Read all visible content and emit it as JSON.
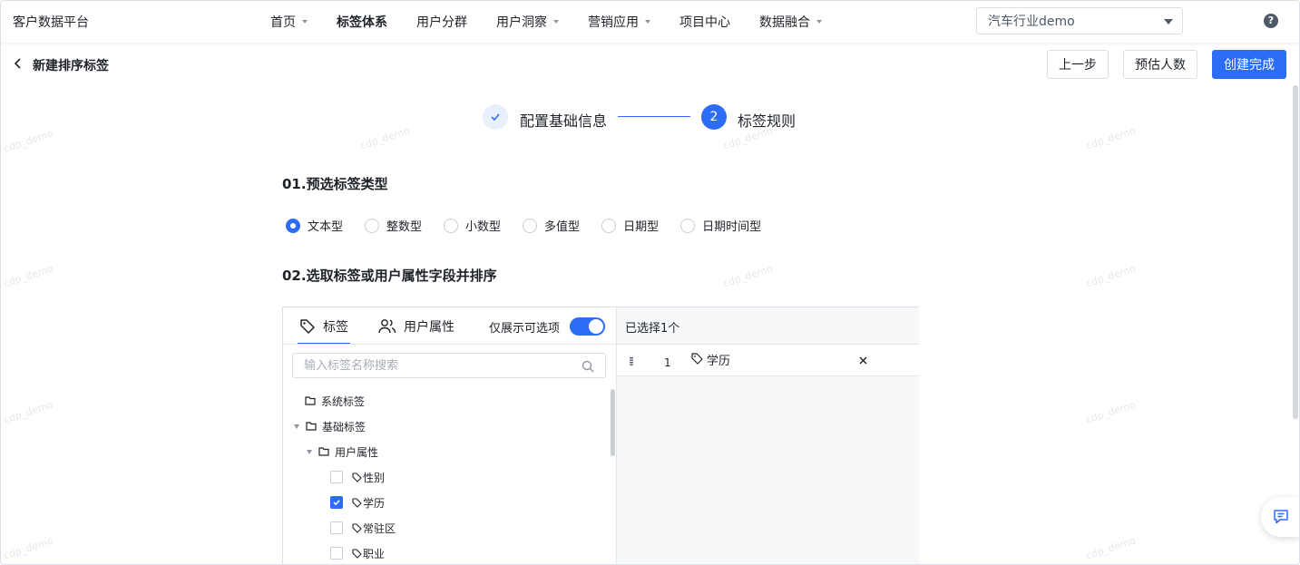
{
  "app": {
    "brand": "客户数据平台"
  },
  "nav": {
    "items": [
      {
        "label": "首页",
        "dropdown": true,
        "active": false
      },
      {
        "label": "标签体系",
        "dropdown": false,
        "active": true
      },
      {
        "label": "用户分群",
        "dropdown": false,
        "active": false
      },
      {
        "label": "用户洞察",
        "dropdown": true,
        "active": false
      },
      {
        "label": "营销应用",
        "dropdown": true,
        "active": false
      },
      {
        "label": "项目中心",
        "dropdown": false,
        "active": false
      },
      {
        "label": "数据融合",
        "dropdown": true,
        "active": false
      }
    ],
    "org_select": "汽车行业demo",
    "help": "?"
  },
  "header": {
    "title": "新建排序标签",
    "prev_label": "上一步",
    "estimate_label": "预估人数",
    "create_label": "创建完成"
  },
  "steps": {
    "step1_label": "配置基础信息",
    "step2_number": "2",
    "step2_label": "标签规则"
  },
  "section1": {
    "title": "01.预选标签类型",
    "options": [
      "文本型",
      "整数型",
      "小数型",
      "多值型",
      "日期型",
      "日期时间型"
    ],
    "selected": "文本型"
  },
  "section2": {
    "title": "02.选取标签或用户属性字段并排序"
  },
  "selector": {
    "tab_tag": "标签",
    "tab_user": "用户属性",
    "toggle_label": "仅展示可选项",
    "toggle_on": true,
    "search_placeholder": "输入标签名称搜索",
    "tree": {
      "system": "系统标签",
      "basic": "基础标签",
      "user_attr": "用户属性",
      "leaves": [
        {
          "label": "性别",
          "checked": false
        },
        {
          "label": "学历",
          "checked": true
        },
        {
          "label": "常驻区",
          "checked": false
        },
        {
          "label": "职业",
          "checked": false
        }
      ]
    },
    "selected_header": "已选择1个",
    "selected_items": [
      {
        "index": "1",
        "label": "学历"
      }
    ]
  },
  "watermark": "cdp_demo",
  "colors": {
    "primary": "#2d6df6",
    "border": "#dcdfe6",
    "panel_bg": "#f7f8fa"
  }
}
